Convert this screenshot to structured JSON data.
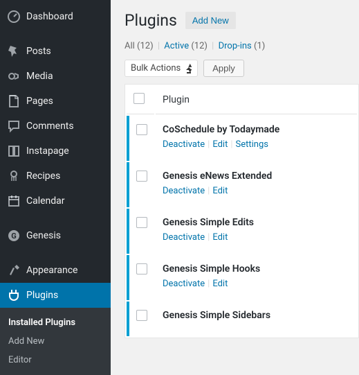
{
  "sidebar": {
    "items": [
      {
        "label": "Dashboard"
      },
      {
        "label": "Posts"
      },
      {
        "label": "Media"
      },
      {
        "label": "Pages"
      },
      {
        "label": "Comments"
      },
      {
        "label": "Instapage"
      },
      {
        "label": "Recipes"
      },
      {
        "label": "Calendar"
      },
      {
        "label": "Genesis"
      },
      {
        "label": "Appearance"
      },
      {
        "label": "Plugins"
      }
    ],
    "submenu": [
      {
        "label": "Installed Plugins"
      },
      {
        "label": "Add New"
      },
      {
        "label": "Editor"
      }
    ]
  },
  "page": {
    "title": "Plugins",
    "add_new": "Add New"
  },
  "filters": {
    "all_label": "All",
    "all_count": "(12)",
    "active_label": "Active",
    "active_count": "(12)",
    "dropins_label": "Drop-ins",
    "dropins_count": "(1)"
  },
  "bulk": {
    "actions_label": "Bulk Actions",
    "apply": "Apply"
  },
  "table": {
    "col_plugin": "Plugin"
  },
  "plugins": [
    {
      "name": "CoSchedule by Todaymade",
      "actions": [
        "Deactivate",
        "Edit",
        "Settings"
      ]
    },
    {
      "name": "Genesis eNews Extended",
      "actions": [
        "Deactivate",
        "Edit"
      ]
    },
    {
      "name": "Genesis Simple Edits",
      "actions": [
        "Deactivate",
        "Edit"
      ]
    },
    {
      "name": "Genesis Simple Hooks",
      "actions": [
        "Deactivate",
        "Edit"
      ]
    },
    {
      "name": "Genesis Simple Sidebars",
      "actions": []
    }
  ]
}
